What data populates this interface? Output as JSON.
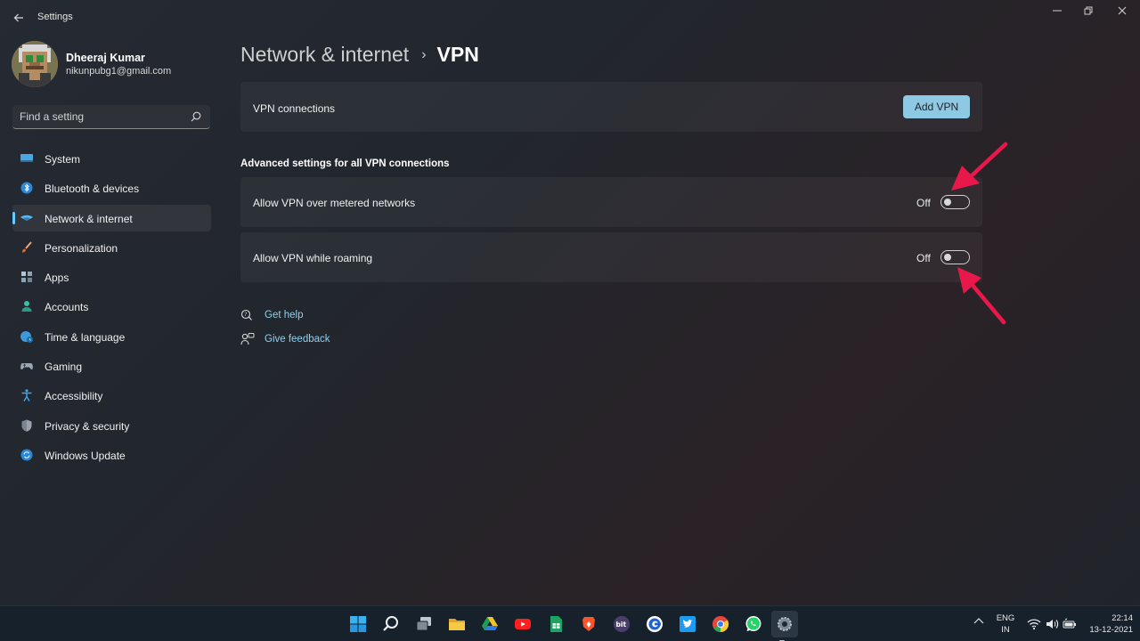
{
  "window": {
    "app_title": "Settings",
    "back_icon": "arrow-left-icon",
    "controls": [
      "minimize-icon",
      "restore-icon",
      "close-icon"
    ]
  },
  "profile": {
    "name": "Dheeraj Kumar",
    "email": "nikunpubg1@gmail.com"
  },
  "search": {
    "placeholder": "Find a setting"
  },
  "sidebar": {
    "items": [
      {
        "label": "System",
        "icon": "system-icon",
        "active": false
      },
      {
        "label": "Bluetooth & devices",
        "icon": "bluetooth-icon",
        "active": false
      },
      {
        "label": "Network & internet",
        "icon": "network-icon",
        "active": true
      },
      {
        "label": "Personalization",
        "icon": "brush-icon",
        "active": false
      },
      {
        "label": "Apps",
        "icon": "apps-icon",
        "active": false
      },
      {
        "label": "Accounts",
        "icon": "person-icon",
        "active": false
      },
      {
        "label": "Time & language",
        "icon": "globe-clock-icon",
        "active": false
      },
      {
        "label": "Gaming",
        "icon": "gamepad-icon",
        "active": false
      },
      {
        "label": "Accessibility",
        "icon": "accessibility-icon",
        "active": false
      },
      {
        "label": "Privacy & security",
        "icon": "shield-icon",
        "active": false
      },
      {
        "label": "Windows Update",
        "icon": "update-icon",
        "active": false
      }
    ]
  },
  "breadcrumb": {
    "parent": "Network & internet",
    "separator": "›",
    "current": "VPN"
  },
  "vpn_connections": {
    "label": "VPN connections",
    "button": "Add VPN"
  },
  "advanced": {
    "heading": "Advanced settings for all VPN connections",
    "settings": [
      {
        "label": "Allow VPN over metered networks",
        "state": "Off",
        "on": false
      },
      {
        "label": "Allow VPN while roaming",
        "state": "Off",
        "on": false
      }
    ]
  },
  "links": {
    "help": "Get help",
    "feedback": "Give feedback"
  },
  "taskbar": {
    "apps": [
      "windows-start-icon",
      "search-icon",
      "task-view-icon",
      "file-explorer-icon",
      "google-drive-icon",
      "youtube-icon",
      "google-sheets-icon",
      "brave-icon",
      "bit-icon",
      "ccleaner-icon",
      "twitter-icon",
      "chrome-icon",
      "whatsapp-icon",
      "settings-icon"
    ],
    "active_app": "settings-icon",
    "language_line1": "ENG",
    "language_line2": "IN",
    "time": "22:14",
    "date": "13-12-2021"
  },
  "colors": {
    "accent": "#60cdff",
    "button": "#8ec9e3",
    "link": "#8fd1ee",
    "annotation_arrow": "#e8194a"
  }
}
